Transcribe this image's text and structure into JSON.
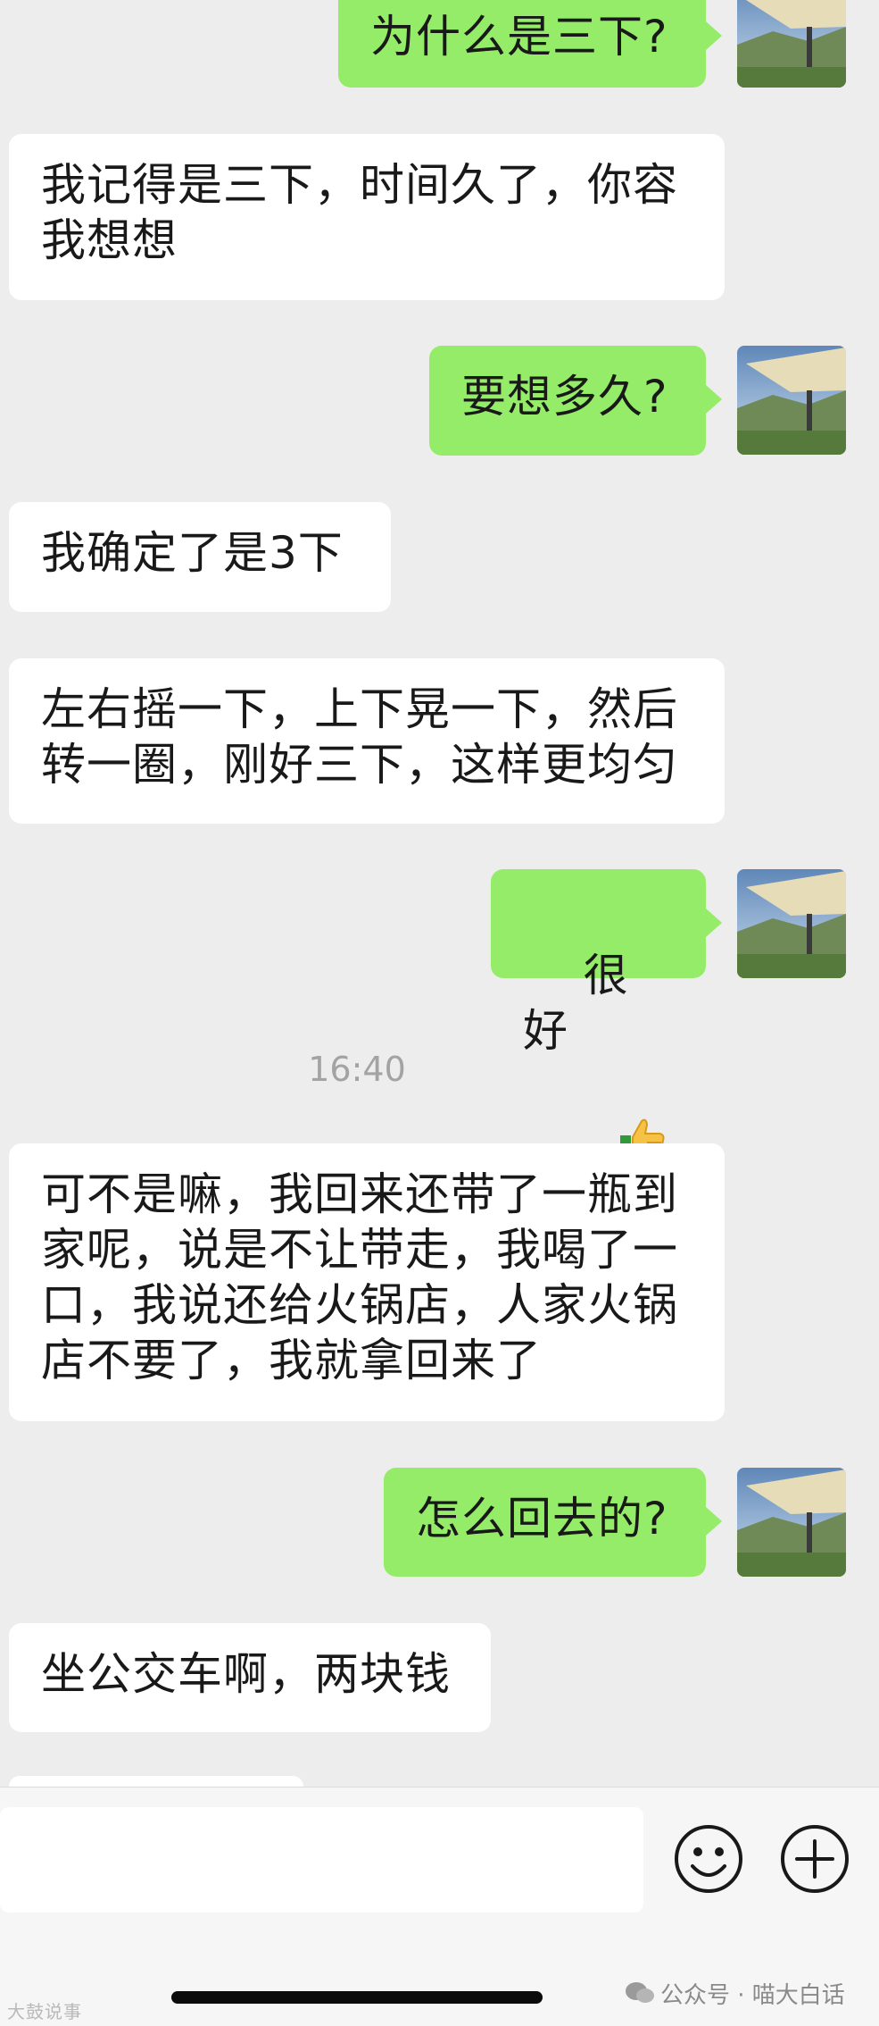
{
  "messages": [
    {
      "side": "out",
      "text": "为什么是三下?"
    },
    {
      "side": "in",
      "text": "我记得是三下，时间久了，你容\n我想想"
    },
    {
      "side": "out",
      "text": "要想多久?"
    },
    {
      "side": "in",
      "text": "我确定了是3下"
    },
    {
      "side": "in",
      "text": "左右摇一下，上下晃一下，然后\n转一圈，刚好三下，这样更均匀"
    },
    {
      "side": "out",
      "text": "很好"
    },
    {
      "side": "in",
      "text": "可不是嘛，我回来还带了一瓶到\n家呢，说是不让带走，我喝了一\n口，我说还给火锅店，人家火锅\n店不要了，我就拿回来了"
    },
    {
      "side": "out",
      "text": "怎么回去的?"
    },
    {
      "side": "in",
      "text": "坐公交车啊，两块钱"
    }
  ],
  "timestamp": "16:40",
  "emoji": "thumbs-up",
  "input_bar": {
    "emoji_button_icon": "smiley-icon",
    "more_button_icon": "plus-circle-icon"
  },
  "watermark": {
    "source": "公众号 · 喵大白话",
    "left_mark": "大鼓说事"
  },
  "colors": {
    "background": "#ededed",
    "incoming_bubble": "#ffffff",
    "outgoing_bubble": "#95ec69",
    "text": "#191919",
    "timestamp": "#a3a3a3"
  }
}
